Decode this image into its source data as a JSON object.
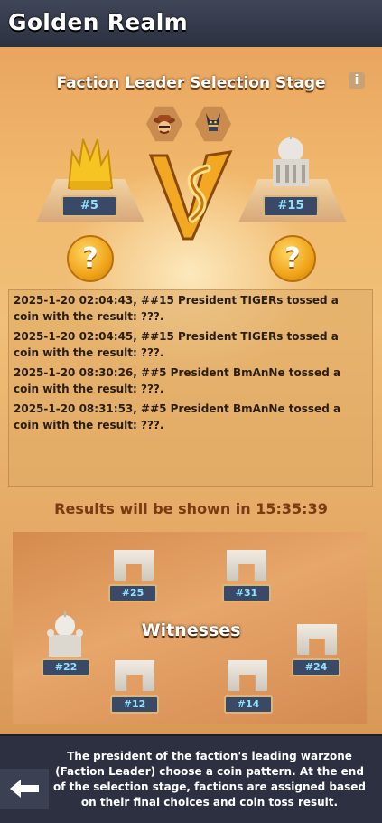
{
  "header": {
    "title": "Golden Realm"
  },
  "stage": {
    "title": "Faction Leader Selection Stage"
  },
  "icons": {
    "info": "info-icon",
    "pattern_left": "cowboy-head-icon",
    "pattern_right": "anubis-head-icon",
    "coin": "question-coin-icon",
    "back": "back-arrow-icon"
  },
  "leaders": {
    "left": {
      "zone": "#5",
      "coin_text": "?"
    },
    "right": {
      "zone": "#15",
      "coin_text": "?"
    }
  },
  "logs": [
    "2025-1-20 02:04:43, ##15 President TIGERs tossed a coin with the result: ???.",
    "2025-1-20 02:04:45, ##15 President TIGERs tossed a coin with the result: ???.",
    "2025-1-20 08:30:26, ##5 President BmAnNe tossed a coin with the result: ???.",
    "2025-1-20 08:31:53, ##5 President BmAnNe tossed a coin with the result: ???."
  ],
  "countdown": {
    "text": "Results will be shown in 15:35:39"
  },
  "witnesses": {
    "label": "Witnesses",
    "zones": [
      "#25",
      "#31",
      "#22",
      "#24",
      "#12",
      "#14"
    ]
  },
  "footer": {
    "text": "The president of the faction's leading warzone (Faction Leader) choose a coin pattern. At the end of the selection stage, factions are assigned based on their final choices and coin toss result."
  },
  "colors": {
    "accent": "#f0a419",
    "tag_text": "#8fe3ff",
    "header_bg": "#3f4658"
  }
}
